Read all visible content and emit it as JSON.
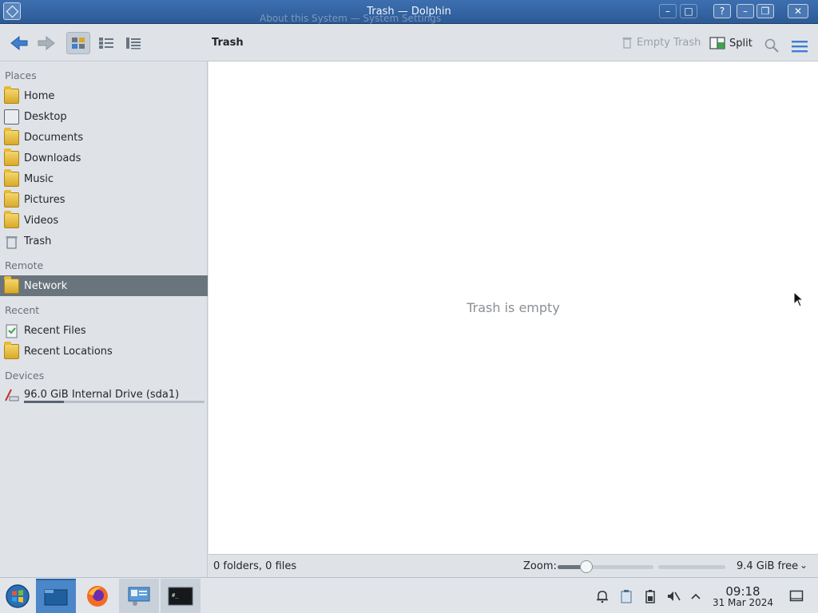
{
  "window": {
    "title": "Trash — Dolphin",
    "background_ghost_title": "About this System — System Settings"
  },
  "toolbar": {
    "back_icon": "arrow-left-icon",
    "forward_icon": "arrow-right-icon",
    "view_modes": [
      "icons-view-icon",
      "compact-view-icon",
      "details-view-icon"
    ],
    "location": "Trash",
    "empty_trash_label": "Empty Trash",
    "split_label": "Split",
    "search_icon": "search-icon",
    "menu_icon": "hamburger-menu-icon"
  },
  "sidebar": {
    "sections": {
      "places": "Places",
      "remote": "Remote",
      "recent": "Recent",
      "devices": "Devices"
    },
    "places": [
      {
        "label": "Home",
        "icon": "folder-home-icon"
      },
      {
        "label": "Desktop",
        "icon": "desktop-icon"
      },
      {
        "label": "Documents",
        "icon": "folder-documents-icon"
      },
      {
        "label": "Downloads",
        "icon": "folder-downloads-icon"
      },
      {
        "label": "Music",
        "icon": "folder-music-icon"
      },
      {
        "label": "Pictures",
        "icon": "folder-pictures-icon"
      },
      {
        "label": "Videos",
        "icon": "folder-videos-icon"
      },
      {
        "label": "Trash",
        "icon": "trash-icon"
      }
    ],
    "remote": [
      {
        "label": "Network",
        "icon": "folder-network-icon",
        "selected": true
      }
    ],
    "recent": [
      {
        "label": "Recent Files",
        "icon": "recent-files-icon"
      },
      {
        "label": "Recent Locations",
        "icon": "recent-locations-icon"
      }
    ],
    "devices": [
      {
        "label": "96.0 GiB Internal Drive (sda1)",
        "icon": "hard-drive-icon",
        "usage_fraction": 0.22
      }
    ]
  },
  "content": {
    "empty_message": "Trash is empty"
  },
  "statusbar": {
    "summary": "0 folders, 0 files",
    "zoom_label": "Zoom:",
    "zoom_level_fraction": 0.3,
    "free_space": "9.4 GiB free"
  },
  "taskbar": {
    "launcher_icon": "application-launcher-icon",
    "tasks": [
      {
        "name": "dolphin-file-manager-icon",
        "state": "active"
      },
      {
        "name": "firefox-icon",
        "state": "idle"
      },
      {
        "name": "system-settings-icon",
        "state": "running"
      },
      {
        "name": "terminal-icon",
        "state": "running"
      }
    ],
    "tray": [
      "notifications-bell-icon",
      "clipboard-icon",
      "battery-icon",
      "volume-muted-icon",
      "tray-expand-chevron-icon"
    ],
    "clock": {
      "time": "09:18",
      "date": "31 Mar 2024"
    },
    "show_desktop_icon": "show-desktop-icon"
  },
  "colors": {
    "accent": "#4a86c8",
    "selection": "#6a747d",
    "window_bg": "#dfe3e8",
    "content_bg": "#ffffff"
  }
}
